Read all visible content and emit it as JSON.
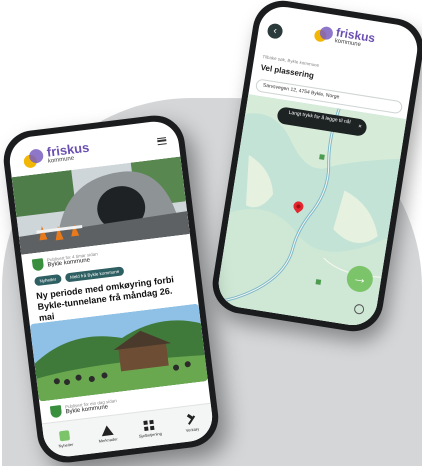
{
  "brand": {
    "name": "friskus",
    "subtitle": "kommune"
  },
  "map_screen": {
    "breadcrumb": "Tilbake søk, Bykle kommune",
    "title": "Vel plassering",
    "address_value": "Sarvsvegen 12, 4754 Bykle, Norge",
    "toast_text": "Langt trykk for å legge til nål",
    "toast_close": "×",
    "fab_label": "→"
  },
  "feed_screen": {
    "post1": {
      "meta_time": "Publisert for 4 timar sidan",
      "meta_org": "Bykle kommune",
      "tags": [
        "Nyheiter",
        "Meld frå Bykle kommune"
      ],
      "headline": "Ny periode med omkøyring forbi Bykle-tunnelane frå måndag 26. mai"
    },
    "post2": {
      "meta_time": "Publisert for ein dag sidan",
      "meta_org": "Bykle kommune"
    },
    "nav": [
      {
        "label": "Nyheiter",
        "icon": "newspaper-icon"
      },
      {
        "label": "Merknader",
        "icon": "warning-icon"
      },
      {
        "label": "Sjølbetjening",
        "icon": "grid-icon"
      },
      {
        "label": "Verktøy",
        "icon": "tools-icon"
      }
    ]
  },
  "colors": {
    "brand_purple": "#6a4fb0",
    "brand_yellow": "#f2b705",
    "accent_green": "#7cc46a",
    "tag_teal": "#2e5f62",
    "map_water": "#b9ddd3"
  }
}
